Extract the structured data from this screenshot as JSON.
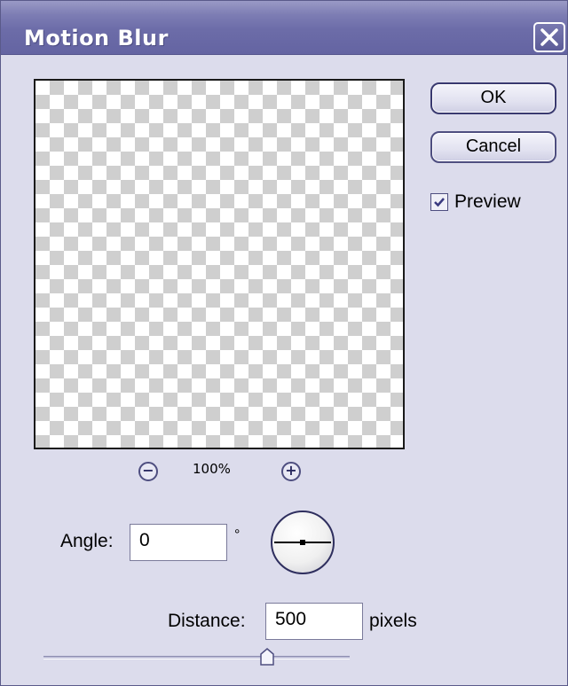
{
  "window": {
    "title": "Motion Blur",
    "close_icon": "close-x-icon"
  },
  "buttons": {
    "ok_label": "OK",
    "cancel_label": "Cancel"
  },
  "preview": {
    "label": "Preview",
    "checked": true
  },
  "zoom": {
    "level": "100%",
    "zoom_out_glyph": "−",
    "zoom_in_glyph": "+"
  },
  "angle": {
    "label": "Angle:",
    "value": "0",
    "unit": "°"
  },
  "distance": {
    "label": "Distance:",
    "value": "500",
    "unit": "pixels",
    "slider_fraction": 0.73
  },
  "colors": {
    "titlebar": "#6c6ca8",
    "dialog_bg": "#dcdcec",
    "checker_gray": "#cfcfcf"
  }
}
